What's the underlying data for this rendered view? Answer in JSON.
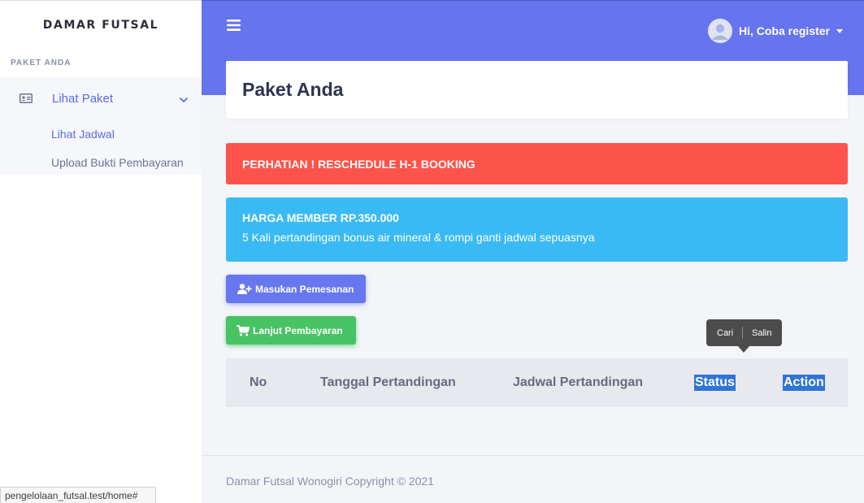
{
  "sidebar": {
    "brand": "DAMAR FUTSAL",
    "section_header": "PAKET ANDA",
    "menu": {
      "label": "Lihat Paket",
      "icon": "id-card-icon",
      "sub_items": [
        {
          "label": "Lihat Jadwal"
        },
        {
          "label": "Upload Bukti Pembayaran"
        }
      ]
    }
  },
  "status_bar": {
    "url": "pengelolaan_futsal.test/home#"
  },
  "header": {
    "user_greeting": "Hi, Coba register",
    "bg_color": "#6674ee"
  },
  "page": {
    "title": "Paket Anda"
  },
  "alerts": {
    "warning": "PERHATIAN ! RESCHEDULE H-1 BOOKING",
    "info_title": "HARGA MEMBER RP.350.000",
    "info_body": "5 Kali pertandingan bonus air mineral & rompi ganti jadwal sepuasnya"
  },
  "buttons": {
    "add_order": "Masukan Pemesanan",
    "continue_payment": "Lanjut Pembayaran"
  },
  "table": {
    "columns": [
      "No",
      "Tanggal Pertandingan",
      "Jadwal Pertandingan",
      "Status",
      "Action"
    ]
  },
  "context_popup": {
    "search": "Cari",
    "copy": "Salin"
  },
  "footer": {
    "text": "Damar Futsal Wonogiri Copyright © 2021"
  },
  "colors": {
    "primary": "#6777ef",
    "danger": "#fc544b",
    "info": "#3abaf4",
    "success": "#47c363"
  }
}
